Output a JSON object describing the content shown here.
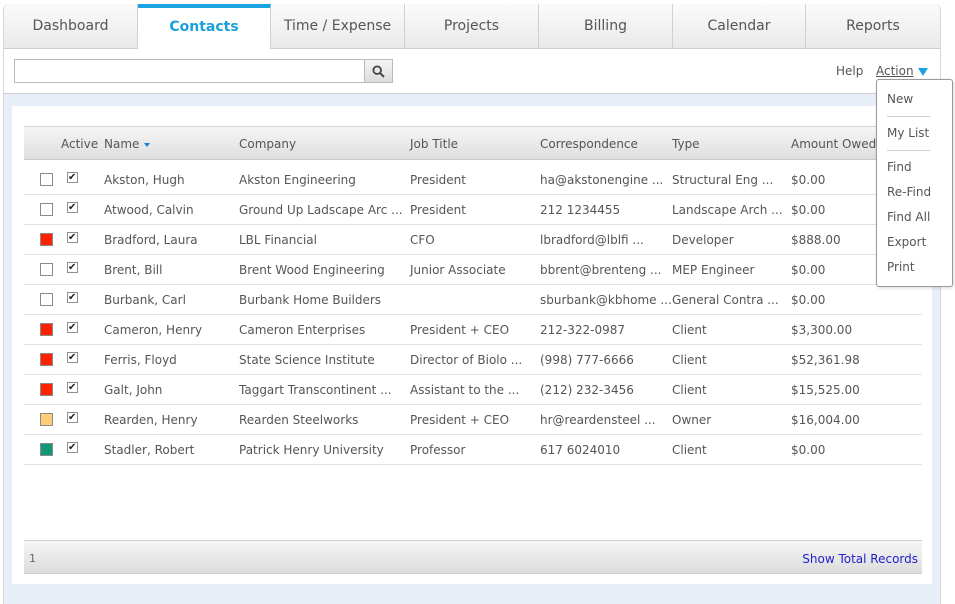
{
  "tabs": [
    "Dashboard",
    "Contacts",
    "Time / Expense",
    "Projects",
    "Billing",
    "Calendar",
    "Reports"
  ],
  "toolbar": {
    "search_value": "",
    "help_label": "Help",
    "action_label": "Action"
  },
  "action_menu": {
    "group1": [
      "New"
    ],
    "group2": [
      "My List"
    ],
    "group3": [
      "Find",
      "Re-Find",
      "Find All",
      "Export",
      "Print"
    ]
  },
  "grid": {
    "columns": {
      "active": "Active",
      "name": "Name",
      "company": "Company",
      "job_title": "Job Title",
      "correspondence": "Correspondence",
      "type": "Type",
      "amount_owed": "Amount Owed"
    },
    "rows": [
      {
        "color": "#ffffff",
        "name": "Akston, Hugh",
        "company": "Akston Engineering",
        "job_title": "President",
        "correspondence": "ha@akstonengine ...",
        "type": "Structural Eng ...",
        "amount_owed": "$0.00"
      },
      {
        "color": "#ffffff",
        "name": "Atwood, Calvin",
        "company": "Ground Up Ladscape Arc ...",
        "job_title": "President",
        "correspondence": "212 1234455",
        "type": "Landscape Arch ...",
        "amount_owed": "$0.00"
      },
      {
        "color": "#ff2200",
        "name": "Bradford, Laura",
        "company": "LBL Financial",
        "job_title": "CFO",
        "correspondence": "lbradford@lblfi ...",
        "type": "Developer",
        "amount_owed": "$888.00"
      },
      {
        "color": "#ffffff",
        "name": "Brent, Bill",
        "company": "Brent Wood Engineering",
        "job_title": "Junior Associate",
        "correspondence": "bbrent@brenteng ...",
        "type": "MEP Engineer",
        "amount_owed": "$0.00"
      },
      {
        "color": "#ffffff",
        "name": "Burbank, Carl",
        "company": "Burbank Home Builders",
        "job_title": "",
        "correspondence": "sburbank@kbhome ...",
        "type": "General Contra ...",
        "amount_owed": "$0.00"
      },
      {
        "color": "#ff2200",
        "name": "Cameron, Henry",
        "company": "Cameron Enterprises",
        "job_title": "President + CEO",
        "correspondence": "212-322-0987",
        "type": "Client",
        "amount_owed": "$3,300.00"
      },
      {
        "color": "#ff2200",
        "name": "Ferris, Floyd",
        "company": "State Science Institute",
        "job_title": "Director of Biolo ...",
        "correspondence": "(998) 777-6666",
        "type": "Client",
        "amount_owed": "$52,361.98"
      },
      {
        "color": "#ff2200",
        "name": "Galt, John",
        "company": "Taggart Transcontinent ...",
        "job_title": "Assistant to the ...",
        "correspondence": "(212) 232-3456",
        "type": "Client",
        "amount_owed": "$15,525.00"
      },
      {
        "color": "#ffcc77",
        "name": "Rearden, Henry",
        "company": "Rearden Steelworks",
        "job_title": "President + CEO",
        "correspondence": "hr@reardensteel ...",
        "type": "Owner",
        "amount_owed": "$16,004.00"
      },
      {
        "color": "#119977",
        "name": "Stadler, Robert",
        "company": "Patrick Henry University",
        "job_title": "Professor",
        "correspondence": "617 6024010",
        "type": "Client",
        "amount_owed": "$0.00"
      }
    ]
  },
  "footer": {
    "page": "1",
    "total_link": "Show Total Records"
  },
  "colors": {
    "accent": "#1aa3e0",
    "link": "#2222cc",
    "background": "#e8eef8"
  }
}
